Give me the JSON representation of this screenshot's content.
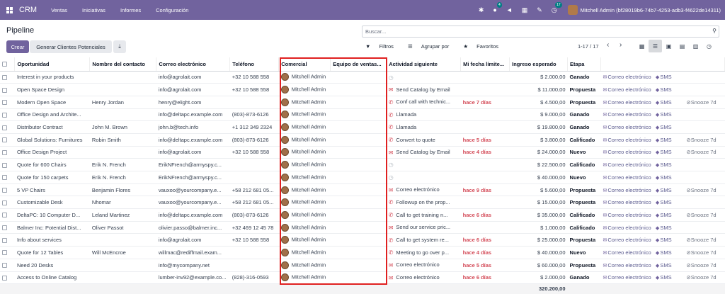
{
  "navbar": {
    "app_name": "CRM",
    "menus": [
      "Ventas",
      "Iniciativas",
      "Informes",
      "Configuración"
    ],
    "chat_badge": "4",
    "activity_badge": "17",
    "user_name": "Mitchell Admin (bf28019b6-74b7-4253-adb3-f4622de14311)"
  },
  "page": {
    "title": "Pipeline",
    "create_label": "Crear",
    "generate_label": "Generar Clientes Potenciales",
    "search_placeholder": "Buscar...",
    "filters_label": "Filtros",
    "group_label": "Agrupar por",
    "favorites_label": "Favoritos",
    "pager": "1-17 / 17"
  },
  "table": {
    "headers": [
      "Oportunidad",
      "Nombre del contacto",
      "Correo electrónico",
      "Teléfono",
      "Comercial",
      "Equipo de ventas...",
      "Actividad siguiente",
      "Mi fecha límite...",
      "Ingreso esperado",
      "Etapa"
    ],
    "link_email": "Correo electrónico",
    "link_sms": "SMS",
    "snooze_label": "Snooze 7d",
    "total": "320.200,00",
    "rows": [
      {
        "opp": "Interest in your products",
        "contact": "",
        "email": "info@agrolait.com",
        "phone": "+32 10 588 558",
        "salesperson": "Mitchell Admin",
        "team": "",
        "act_type": "none",
        "activity": "",
        "deadline": "",
        "revenue": "$ 2.000,00",
        "stage": "Ganado",
        "snooze": false
      },
      {
        "opp": "Open Space Design",
        "contact": "",
        "email": "info@agrolait.com",
        "phone": "+32 10 588 558",
        "salesperson": "Mitchell Admin",
        "team": "",
        "act_type": "mail",
        "activity": "Send Catalog by Email",
        "deadline": "",
        "revenue": "$ 11.000,00",
        "stage": "Propuesta",
        "snooze": false
      },
      {
        "opp": "Modern Open Space",
        "contact": "Henry Jordan",
        "email": "henry@elight.com",
        "phone": "",
        "salesperson": "Mitchell Admin",
        "team": "",
        "act_type": "phone",
        "activity": "Conf call with technic...",
        "deadline": "hace 7 días",
        "revenue": "$ 4.500,00",
        "stage": "Propuesta",
        "snooze": true
      },
      {
        "opp": "Office Design and Archite...",
        "contact": "",
        "email": "info@deltapc.example.com",
        "phone": "(803)-873-6126",
        "salesperson": "Mitchell Admin",
        "team": "",
        "act_type": "phone",
        "activity": "Llamada",
        "deadline": "",
        "revenue": "$ 9.000,00",
        "stage": "Ganado",
        "snooze": false
      },
      {
        "opp": "Distributor Contract",
        "contact": "John M. Brown",
        "email": "john.b@tech.info",
        "phone": "+1 312 349 2324",
        "salesperson": "Mitchell Admin",
        "team": "",
        "act_type": "phone",
        "activity": "Llamada",
        "deadline": "",
        "revenue": "$ 19.800,00",
        "stage": "Ganado",
        "snooze": false
      },
      {
        "opp": "Global Solutions: Furnitures",
        "contact": "Robin Smith",
        "email": "info@deltapc.example.com",
        "phone": "(803)-873-6126",
        "salesperson": "Mitchell Admin",
        "team": "",
        "act_type": "phone",
        "activity": "Convert to quote",
        "deadline": "hace 5 días",
        "revenue": "$ 3.800,00",
        "stage": "Calificado",
        "snooze": true
      },
      {
        "opp": "Office Design Project",
        "contact": "",
        "email": "info@agrolait.com",
        "phone": "+32 10 588 558",
        "salesperson": "Mitchell Admin",
        "team": "",
        "act_type": "mail",
        "activity": "Send Catalog by Email",
        "deadline": "hace 4 días",
        "revenue": "$ 24.000,00",
        "stage": "Nuevo",
        "snooze": true
      },
      {
        "opp": "Quote for 600 Chairs",
        "contact": "Erik N. French",
        "email": "ErikNFrench@armyspy.c...",
        "phone": "",
        "salesperson": "Mitchell Admin",
        "team": "",
        "act_type": "none",
        "activity": "",
        "deadline": "",
        "revenue": "$ 22.500,00",
        "stage": "Calificado",
        "snooze": false
      },
      {
        "opp": "Quote for 150 carpets",
        "contact": "Erik N. French",
        "email": "ErikNFrench@armyspy.c...",
        "phone": "",
        "salesperson": "Mitchell Admin",
        "team": "",
        "act_type": "none",
        "activity": "",
        "deadline": "",
        "revenue": "$ 40.000,00",
        "stage": "Nuevo",
        "snooze": false
      },
      {
        "opp": "5 VP Chairs",
        "contact": "Benjamin Flores",
        "email": "vauxoo@yourcompany.e...",
        "phone": "+58 212 681 05...",
        "salesperson": "Mitchell Admin",
        "team": "",
        "act_type": "mail",
        "activity": "Correo electrónico",
        "deadline": "hace 9 días",
        "revenue": "$ 5.600,00",
        "stage": "Propuesta",
        "snooze": true
      },
      {
        "opp": "Customizable Desk",
        "contact": "Nhomar",
        "email": "vauxoo@yourcompany.e...",
        "phone": "+58 212 681 05...",
        "salesperson": "Mitchell Admin",
        "team": "",
        "act_type": "phone",
        "activity": "Followup on the prop...",
        "deadline": "",
        "revenue": "$ 15.000,00",
        "stage": "Propuesta",
        "snooze": false
      },
      {
        "opp": "DeltaPC: 10 Computer D...",
        "contact": "Leland Martinez",
        "email": "info@deltapc.example.com",
        "phone": "(803)-873-6126",
        "salesperson": "Mitchell Admin",
        "team": "",
        "act_type": "phone",
        "activity": "Call to get training n...",
        "deadline": "hace 6 días",
        "revenue": "$ 35.000,00",
        "stage": "Calificado",
        "snooze": true
      },
      {
        "opp": "Balmer Inc: Potential Dist...",
        "contact": "Oliver Passot",
        "email": "olivier.passo@balmer.inc...",
        "phone": "+32 469 12 45 78",
        "salesperson": "Mitchell Admin",
        "team": "",
        "act_type": "mail",
        "activity": "Send our service pric...",
        "deadline": "",
        "revenue": "$ 1.000,00",
        "stage": "Calificado",
        "snooze": false
      },
      {
        "opp": "Info about services",
        "contact": "",
        "email": "info@agrolait.com",
        "phone": "+32 10 588 558",
        "salesperson": "Mitchell Admin",
        "team": "",
        "act_type": "phone",
        "activity": "Call to get system re...",
        "deadline": "hace 6 días",
        "revenue": "$ 25.000,00",
        "stage": "Propuesta",
        "snooze": true
      },
      {
        "opp": "Quote for 12 Tables",
        "contact": "Will McEncroe",
        "email": "willmac@rediffmail.exam...",
        "phone": "",
        "salesperson": "Mitchell Admin",
        "team": "",
        "act_type": "phone",
        "activity": "Meeting to go over p...",
        "deadline": "hace 4 días",
        "revenue": "$ 40.000,00",
        "stage": "Nuevo",
        "snooze": true
      },
      {
        "opp": "Need 20 Desks",
        "contact": "",
        "email": "info@mycompany.net",
        "phone": "",
        "salesperson": "Mitchell Admin",
        "team": "",
        "act_type": "mail",
        "activity": "Correo electrónico",
        "deadline": "hace 5 días",
        "revenue": "$ 60.000,00",
        "stage": "Propuesta",
        "snooze": true
      },
      {
        "opp": "Access to Online Catalog",
        "contact": "",
        "email": "lumber-inv92@example.co...",
        "phone": "(828)-316-0593",
        "salesperson": "Mitchell Admin",
        "team": "",
        "act_type": "mail",
        "activity": "Correo electrónico",
        "deadline": "hace 6 días",
        "revenue": "$ 2.000,00",
        "stage": "Ganado",
        "snooze": true
      }
    ]
  }
}
